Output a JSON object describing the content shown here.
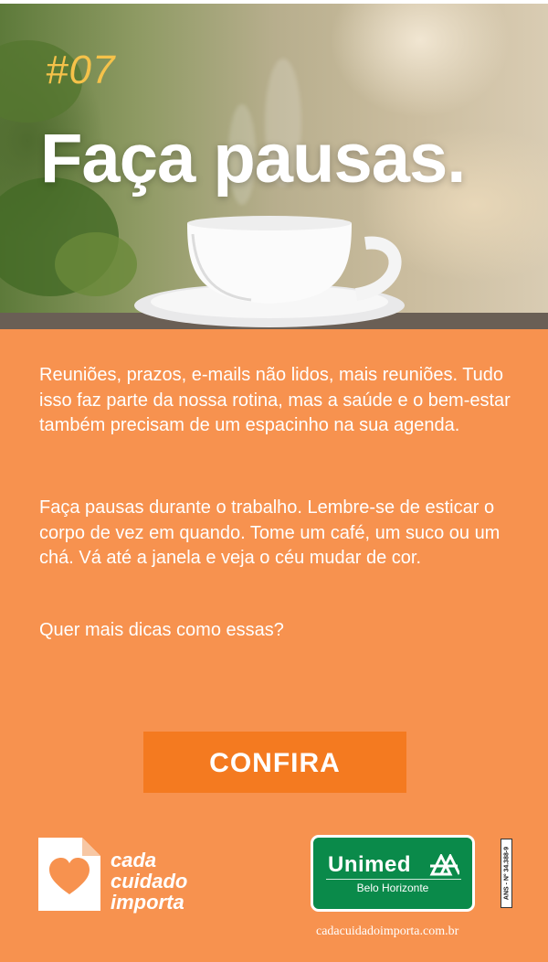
{
  "hero": {
    "tag": "#07",
    "title": "Faça pausas."
  },
  "content": {
    "paragraph1": "Reuniões, prazos, e-mails não lidos, mais reuniões. Tudo isso faz parte da nossa rotina, mas a saúde e o bem-estar também precisam de um espacinho na sua agenda.",
    "paragraph2": "Faça pausas durante o trabalho. Lembre-se de esticar o corpo de vez em quando. Tome um café, um suco ou um chá. Vá até a janela e veja o céu mudar de cor.",
    "question": "Quer mais dicas como essas?",
    "cta_label": "CONFIRA"
  },
  "footer": {
    "campaign": [
      "cada",
      "cuidado",
      "importa"
    ],
    "campaign_icon": "heart-document-icon",
    "unimed_name": "Unimed",
    "unimed_icon": "unimed-trees-icon",
    "unimed_city": "Belo Horizonte",
    "ans": "ANS - Nº 34.388-9",
    "website": "cadacuidadoimporta.com.br"
  },
  "colors": {
    "panel_bg": "#f7924f",
    "cta_bg": "#f47a20",
    "tag": "#f5c24a",
    "unimed_green": "#0a8a4a"
  }
}
